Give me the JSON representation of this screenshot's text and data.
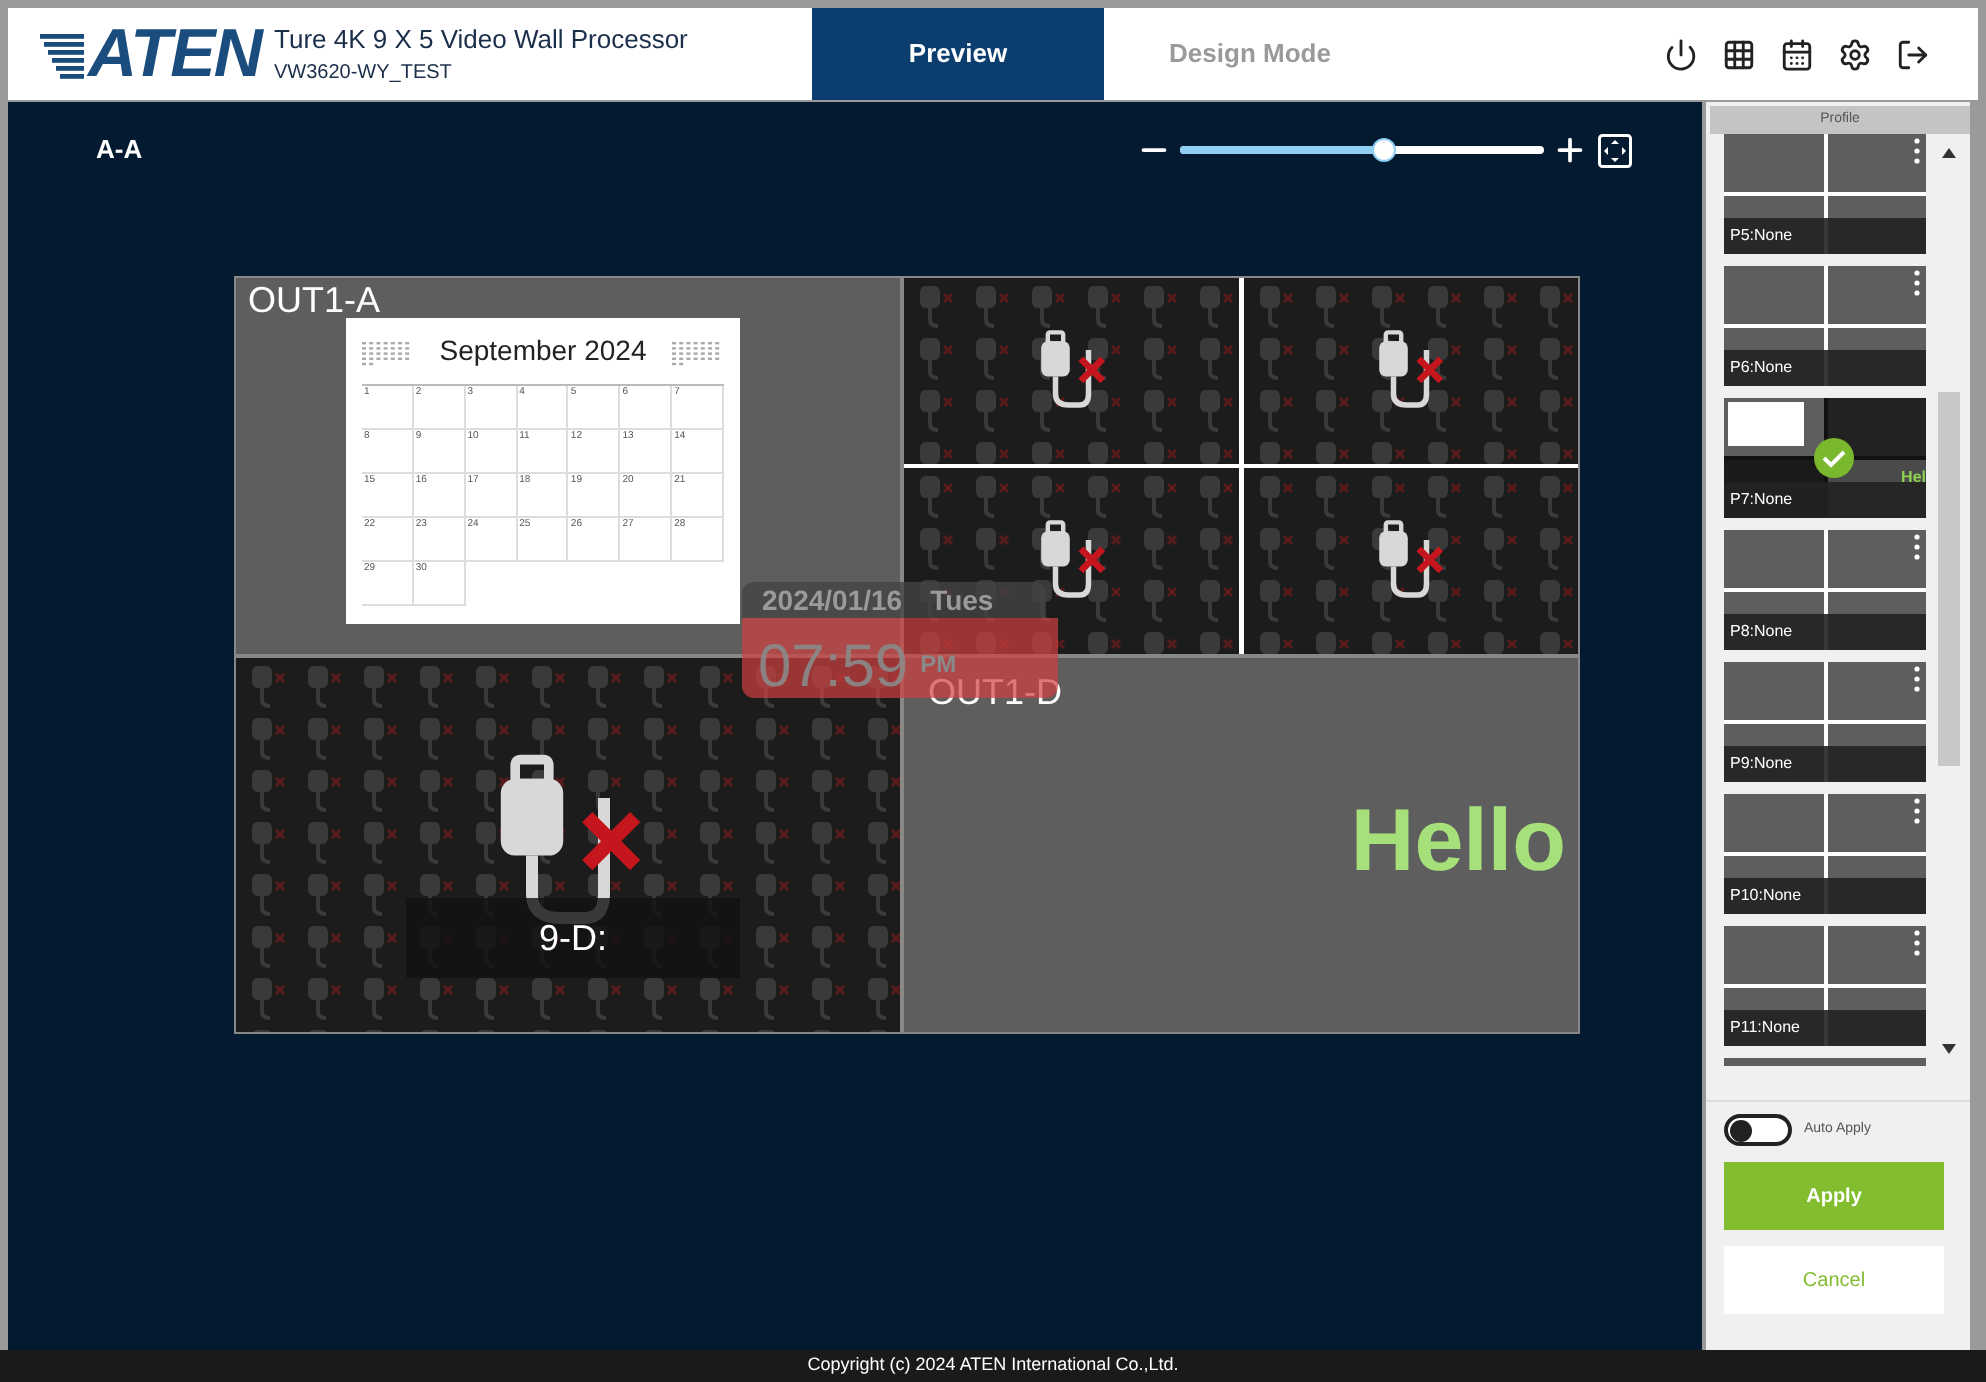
{
  "header": {
    "logo": "ATEN",
    "title": "Ture 4K 9 X 5 Video Wall Processor",
    "subtitle": "VW3620-WY_TEST"
  },
  "tabs": [
    {
      "label": "Preview",
      "selected": true
    },
    {
      "label": "Design Mode",
      "selected": false
    }
  ],
  "canvas": {
    "layout_name": "A-A",
    "zoom": {
      "level": 0.56
    },
    "windows": [
      {
        "kind": "calendar",
        "label": "OUT1-A",
        "title": "September 2024",
        "days": [
          "1",
          "2",
          "3",
          "4",
          "5",
          "6",
          "7",
          "8",
          "9",
          "10",
          "11",
          "12",
          "13",
          "14",
          "15",
          "16",
          "17",
          "18",
          "19",
          "20",
          "21",
          "22",
          "23",
          "24",
          "25",
          "26",
          "27",
          "28",
          "29",
          "30"
        ]
      },
      {
        "kind": "quad_no_signal"
      },
      {
        "kind": "no_signal",
        "caption": "9-D:"
      },
      {
        "kind": "text",
        "label": "OUT1-D",
        "text": "Hello"
      }
    ],
    "clock": {
      "date": "2024/01/16",
      "weekday": "Tues",
      "time": "07:59",
      "period": "PM"
    }
  },
  "profile_panel": {
    "title": "Profile",
    "profiles": [
      {
        "name": "P5:None",
        "selected": false
      },
      {
        "name": "P6:None",
        "selected": false
      },
      {
        "name": "P7:None",
        "selected": true,
        "thumbnail_text": "Hel"
      },
      {
        "name": "P8:None",
        "selected": false
      },
      {
        "name": "P9:None",
        "selected": false
      },
      {
        "name": "P10:None",
        "selected": false
      },
      {
        "name": "P11:None",
        "selected": false
      }
    ],
    "auto_apply": {
      "label": "Auto Apply",
      "on": false
    },
    "buttons": [
      {
        "label": "Apply",
        "kind": "primary"
      },
      {
        "label": "Cancel",
        "kind": "secondary"
      }
    ]
  },
  "footer": "Copyright (c) 2024 ATEN International Co.,Ltd."
}
